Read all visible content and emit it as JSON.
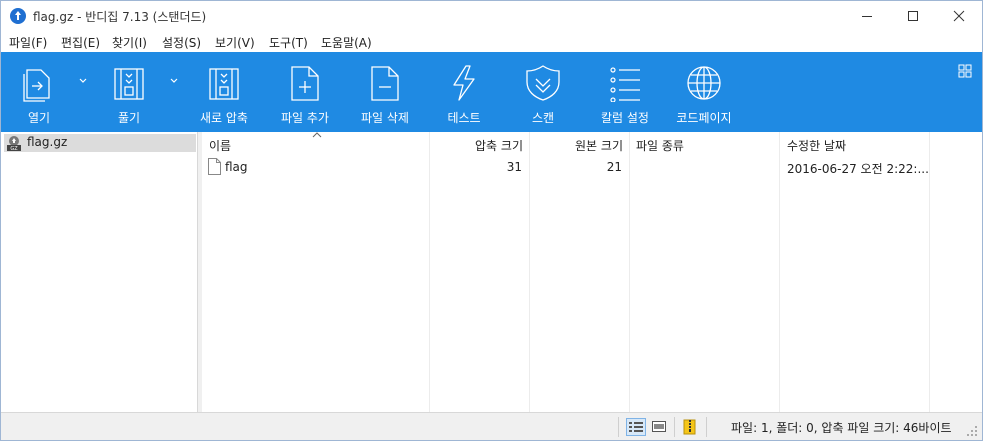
{
  "window": {
    "title": "flag.gz - 반디집 7.13 (스탠더드)"
  },
  "menu": [
    {
      "label": "파일(F)"
    },
    {
      "label": "편집(E)"
    },
    {
      "label": "찾기(I)"
    },
    {
      "label": "설정(S)"
    },
    {
      "label": "보기(V)"
    },
    {
      "label": "도구(T)"
    },
    {
      "label": "도움말(A)"
    }
  ],
  "toolbar": {
    "color": "#1f8ae3",
    "items": [
      {
        "label": "열기",
        "icon": "open-icon"
      },
      {
        "label": "풀기",
        "icon": "extract-icon"
      },
      {
        "label": "새로 압축",
        "icon": "new-archive-icon"
      },
      {
        "label": "파일 추가",
        "icon": "add-file-icon"
      },
      {
        "label": "파일 삭제",
        "icon": "delete-file-icon"
      },
      {
        "label": "테스트",
        "icon": "test-icon"
      },
      {
        "label": "스캔",
        "icon": "scan-icon"
      },
      {
        "label": "칼럼 설정",
        "icon": "column-settings-icon"
      },
      {
        "label": "코드페이지",
        "icon": "codepage-icon"
      }
    ]
  },
  "tree": {
    "items": [
      {
        "label": "flag.gz",
        "icon": "gz-archive-icon"
      }
    ]
  },
  "filelist": {
    "columns": [
      {
        "label": "이름"
      },
      {
        "label": "압축 크기"
      },
      {
        "label": "원본 크기"
      },
      {
        "label": "파일 종류"
      },
      {
        "label": "수정한 날짜"
      }
    ],
    "rows": [
      {
        "name": "flag",
        "packed": "31",
        "size": "21",
        "type": "",
        "modified": "2016-06-27 오전 2:22:..."
      }
    ]
  },
  "statusbar": {
    "text": "파일: 1, 폴더: 0, 압축 파일 크기: 46바이트"
  }
}
